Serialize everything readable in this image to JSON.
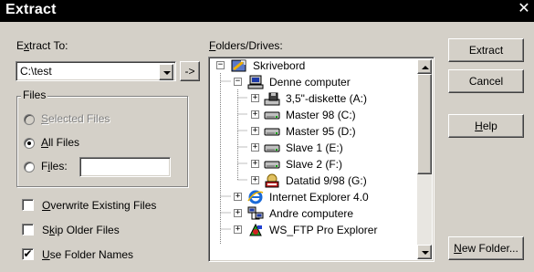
{
  "window": {
    "title": "Extract",
    "close_glyph": "✕"
  },
  "extract_to": {
    "label_prefix": "E",
    "label_ul": "x",
    "label_rest": "tract To:",
    "value": "C:\\test",
    "browse_glyph": "->"
  },
  "folders": {
    "label_ul": "F",
    "label_rest": "olders/Drives:",
    "tree": [
      {
        "label": "Skrivebord",
        "icon": "desktop-icon"
      },
      {
        "label": "Denne computer",
        "icon": "my-computer-icon"
      },
      {
        "label": "3,5\"-diskette (A:)",
        "icon": "floppy-drive-icon"
      },
      {
        "label": "Master 98 (C:)",
        "icon": "hard-drive-icon"
      },
      {
        "label": "Master 95 (D:)",
        "icon": "hard-drive-icon"
      },
      {
        "label": "Slave 1 (E:)",
        "icon": "hard-drive-icon"
      },
      {
        "label": "Slave 2 (F:)",
        "icon": "hard-drive-icon"
      },
      {
        "label": "Datatid 9/98 (G:)",
        "icon": "cd-drive-icon"
      },
      {
        "label": "Internet Explorer 4.0",
        "icon": "internet-explorer-icon"
      },
      {
        "label": "Andre computere",
        "icon": "network-icon"
      },
      {
        "label": "WS_FTP Pro Explorer",
        "icon": "ftp-icon"
      }
    ]
  },
  "files_group": {
    "title": "Files",
    "selected": {
      "ul": "S",
      "rest": "elected Files"
    },
    "all": {
      "ul": "A",
      "rest": "ll Files"
    },
    "files": {
      "pre": "F",
      "ul": "i",
      "rest": "les:"
    },
    "files_value": ""
  },
  "options": {
    "overwrite": {
      "ul": "O",
      "rest": "verwrite Existing Files",
      "checked": false
    },
    "skip": {
      "pre": "S",
      "ul": "k",
      "rest": "ip Older Files",
      "checked": false
    },
    "use_folder": {
      "ul": "U",
      "rest": "se Folder Names",
      "checked": true
    },
    "check_glyph": "✔"
  },
  "buttons": {
    "extract": "Extract",
    "cancel": "Cancel",
    "help": {
      "ul": "H",
      "rest": "elp"
    },
    "new_folder": {
      "ul": "N",
      "rest": "ew Folder..."
    }
  }
}
